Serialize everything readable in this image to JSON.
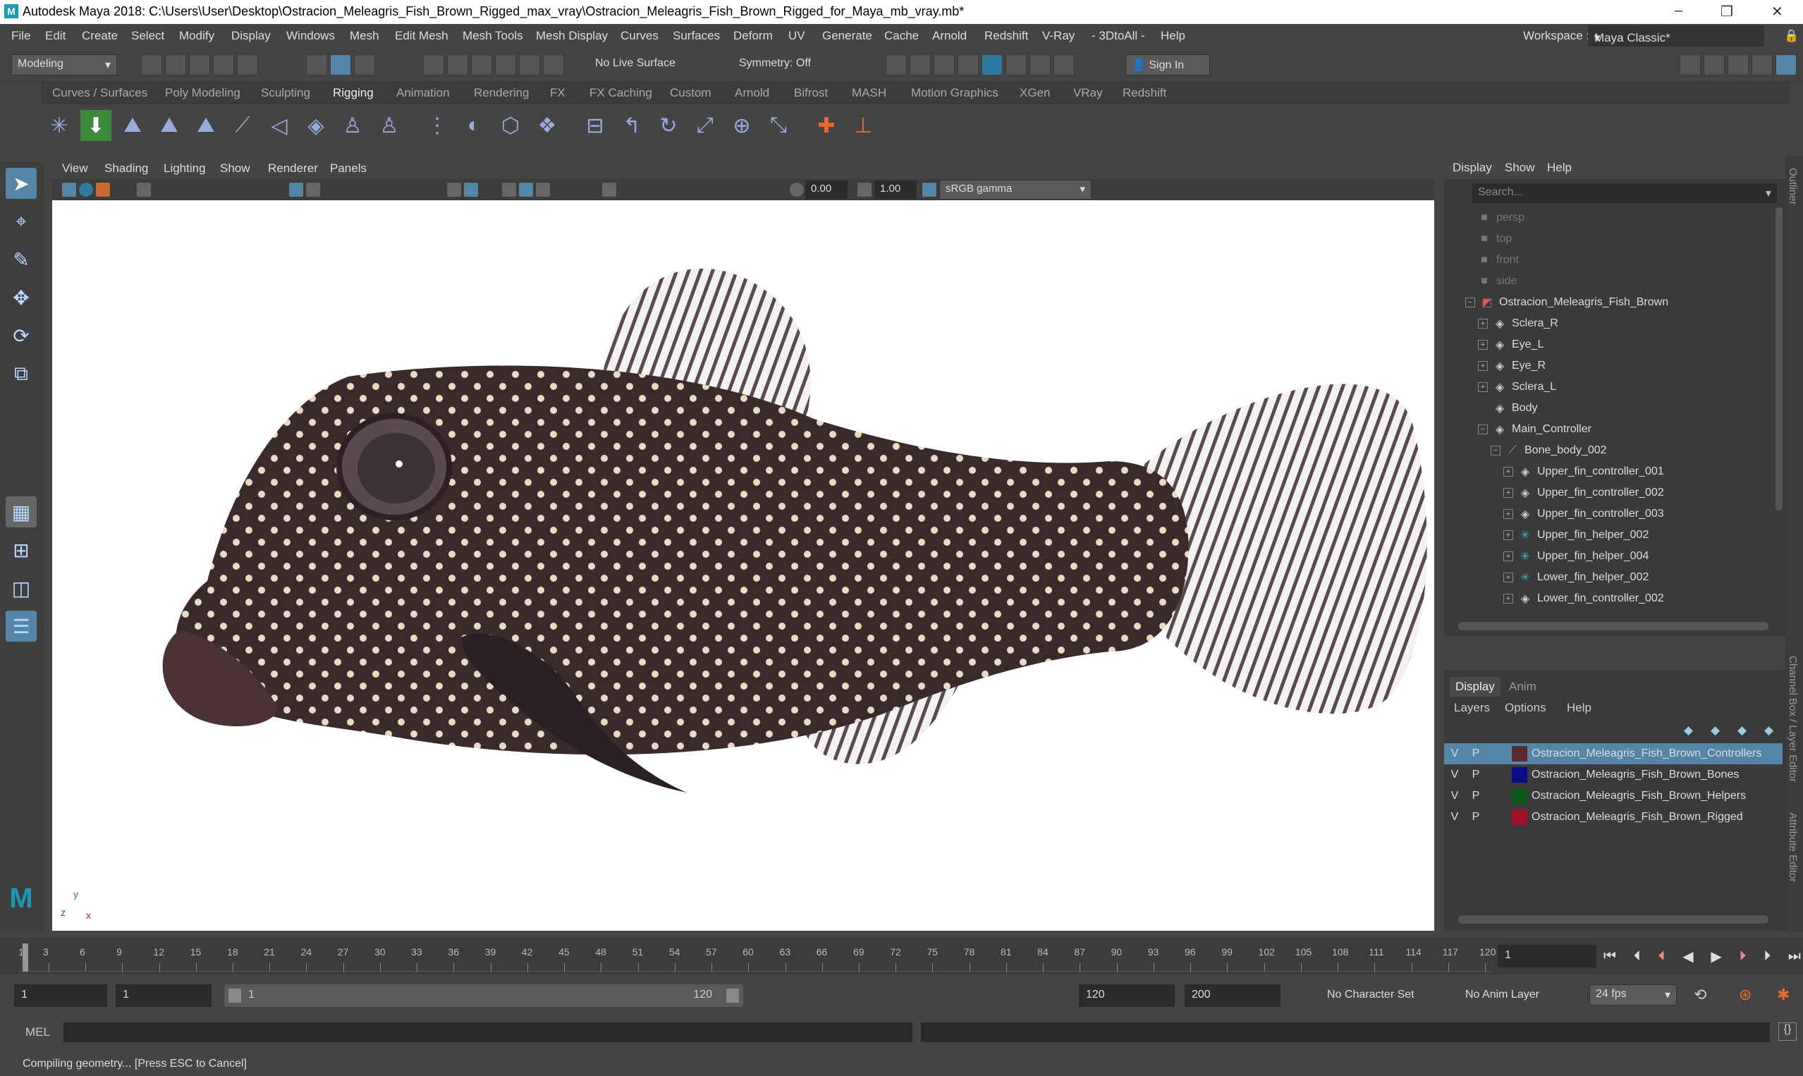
{
  "window": {
    "title": "Autodesk Maya 2018: C:\\Users\\User\\Desktop\\Ostracion_Meleagris_Fish_Brown_Rigged_max_vray\\Ostracion_Meleagris_Fish_Brown_Rigged_for_Maya_mb_vray.mb*",
    "controls": [
      "–",
      "❐",
      "✕"
    ]
  },
  "menubar": {
    "items": [
      "File",
      "Edit",
      "Create",
      "Select",
      "Modify",
      "Display",
      "Windows",
      "Mesh",
      "Edit Mesh",
      "Mesh Tools",
      "Mesh Display",
      "Curves",
      "Surfaces",
      "Deform",
      "UV",
      "Generate",
      "Cache",
      "Arnold",
      "Redshift",
      "V-Ray",
      "- 3DtoAll -",
      "Help"
    ],
    "workspace_label": "Workspace :",
    "workspace_value": "Maya Classic*"
  },
  "statusline": {
    "mode": "Modeling",
    "live_surface": "No Live Surface",
    "symmetry": "Symmetry: Off",
    "sign_in": "Sign In"
  },
  "shelf": {
    "tabs": [
      "Curves / Surfaces",
      "Poly Modeling",
      "Sculpting",
      "Rigging",
      "Animation",
      "Rendering",
      "FX",
      "FX Caching",
      "Custom",
      "Arnold",
      "Bifrost",
      "MASH",
      "Motion Graphics",
      "XGen",
      "VRay",
      "Redshift"
    ],
    "active_tab": "Rigging"
  },
  "viewport": {
    "menu": [
      "View",
      "Shading",
      "Lighting",
      "Show",
      "Renderer",
      "Panels"
    ],
    "exposure": "0.00",
    "gamma": "1.00",
    "color_space": "sRGB gamma",
    "axis_y": "y",
    "axis_z": "z",
    "axis_x": "x"
  },
  "outliner": {
    "menu": [
      "Display",
      "Show",
      "Help"
    ],
    "search_placeholder": "Search...",
    "items": [
      {
        "label": "persp",
        "icon": "camera-icon",
        "dim": true
      },
      {
        "label": "top",
        "icon": "camera-icon",
        "dim": true
      },
      {
        "label": "front",
        "icon": "camera-icon",
        "dim": true
      },
      {
        "label": "side",
        "icon": "camera-icon",
        "dim": true
      },
      {
        "label": "Ostracion_Meleagris_Fish_Brown",
        "icon": "group-icon"
      },
      {
        "label": "Sclera_R",
        "icon": "mesh-icon"
      },
      {
        "label": "Eye_L",
        "icon": "mesh-icon"
      },
      {
        "label": "Eye_R",
        "icon": "mesh-icon"
      },
      {
        "label": "Sclera_L",
        "icon": "mesh-icon"
      },
      {
        "label": "Body",
        "icon": "mesh-icon"
      },
      {
        "label": "Main_Controller",
        "icon": "curve-icon"
      },
      {
        "label": "Bone_body_002",
        "icon": "joint-icon"
      },
      {
        "label": "Upper_fin_controller_001",
        "icon": "curve-icon"
      },
      {
        "label": "Upper_fin_controller_002",
        "icon": "curve-icon"
      },
      {
        "label": "Upper_fin_controller_003",
        "icon": "curve-icon"
      },
      {
        "label": "Upper_fin_helper_002",
        "icon": "helper-icon"
      },
      {
        "label": "Upper_fin_helper_004",
        "icon": "helper-icon"
      },
      {
        "label": "Lower_fin_helper_002",
        "icon": "helper-icon"
      },
      {
        "label": "Lower_fin_controller_002",
        "icon": "curve-icon"
      }
    ]
  },
  "layer_editor": {
    "tabs": [
      "Display",
      "Anim"
    ],
    "menu": [
      "Layers",
      "Options",
      "Help"
    ],
    "layers": [
      {
        "v": "V",
        "p": "P",
        "name": "Ostracion_Meleagris_Fish_Brown_Controllers",
        "color": "#5a2a30",
        "selected": true
      },
      {
        "v": "V",
        "p": "P",
        "name": "Ostracion_Meleagris_Fish_Brown_Bones",
        "color": "#0a0a8a",
        "selected": false
      },
      {
        "v": "V",
        "p": "P",
        "name": "Ostracion_Meleagris_Fish_Brown_Helpers",
        "color": "#0a5a1a",
        "selected": false
      },
      {
        "v": "V",
        "p": "P",
        "name": "Ostracion_Meleagris_Fish_Brown_Rigged",
        "color": "#a0102a",
        "selected": false
      }
    ]
  },
  "side_tabs": [
    "Outliner",
    "Channel Box / Layer Editor",
    "Attribute Editor"
  ],
  "timeline": {
    "ticks": [
      "1",
      "3",
      "6",
      "9",
      "12",
      "15",
      "18",
      "21",
      "24",
      "27",
      "30",
      "33",
      "36",
      "39",
      "42",
      "45",
      "48",
      "51",
      "54",
      "57",
      "60",
      "63",
      "66",
      "69",
      "72",
      "75",
      "78",
      "81",
      "84",
      "87",
      "90",
      "93",
      "96",
      "99",
      "102",
      "105",
      "108",
      "111",
      "114",
      "117",
      "120"
    ],
    "current_frame": "1"
  },
  "range": {
    "start": "1",
    "anim_start": "1",
    "slider_start": "1",
    "slider_end": "120",
    "anim_end": "120",
    "end": "200",
    "character_set": "No Character Set",
    "anim_layer": "No Anim Layer",
    "fps": "24 fps"
  },
  "command": {
    "label": "MEL"
  },
  "help_line": "Compiling geometry... [Press ESC to Cancel]",
  "colors": {
    "accent": "#5285a6",
    "panel": "#444444",
    "viewport_bg": "#ffffff"
  }
}
